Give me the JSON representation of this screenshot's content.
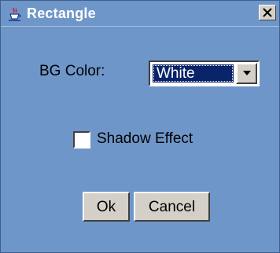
{
  "window": {
    "title": "Rectangle",
    "app_icon": "java-cup-icon",
    "close_icon": "close-icon"
  },
  "form": {
    "bg_color_label": "BG Color:",
    "bg_color_value": "White",
    "dropdown_icon": "chevron-down-icon",
    "shadow_label": "Shadow Effect",
    "shadow_checked": false
  },
  "buttons": {
    "ok_label": "Ok",
    "cancel_label": "Cancel"
  },
  "colors": {
    "window_bg": "#6f96c9",
    "button_face": "#d4d0c8",
    "selection": "#0a246a"
  }
}
